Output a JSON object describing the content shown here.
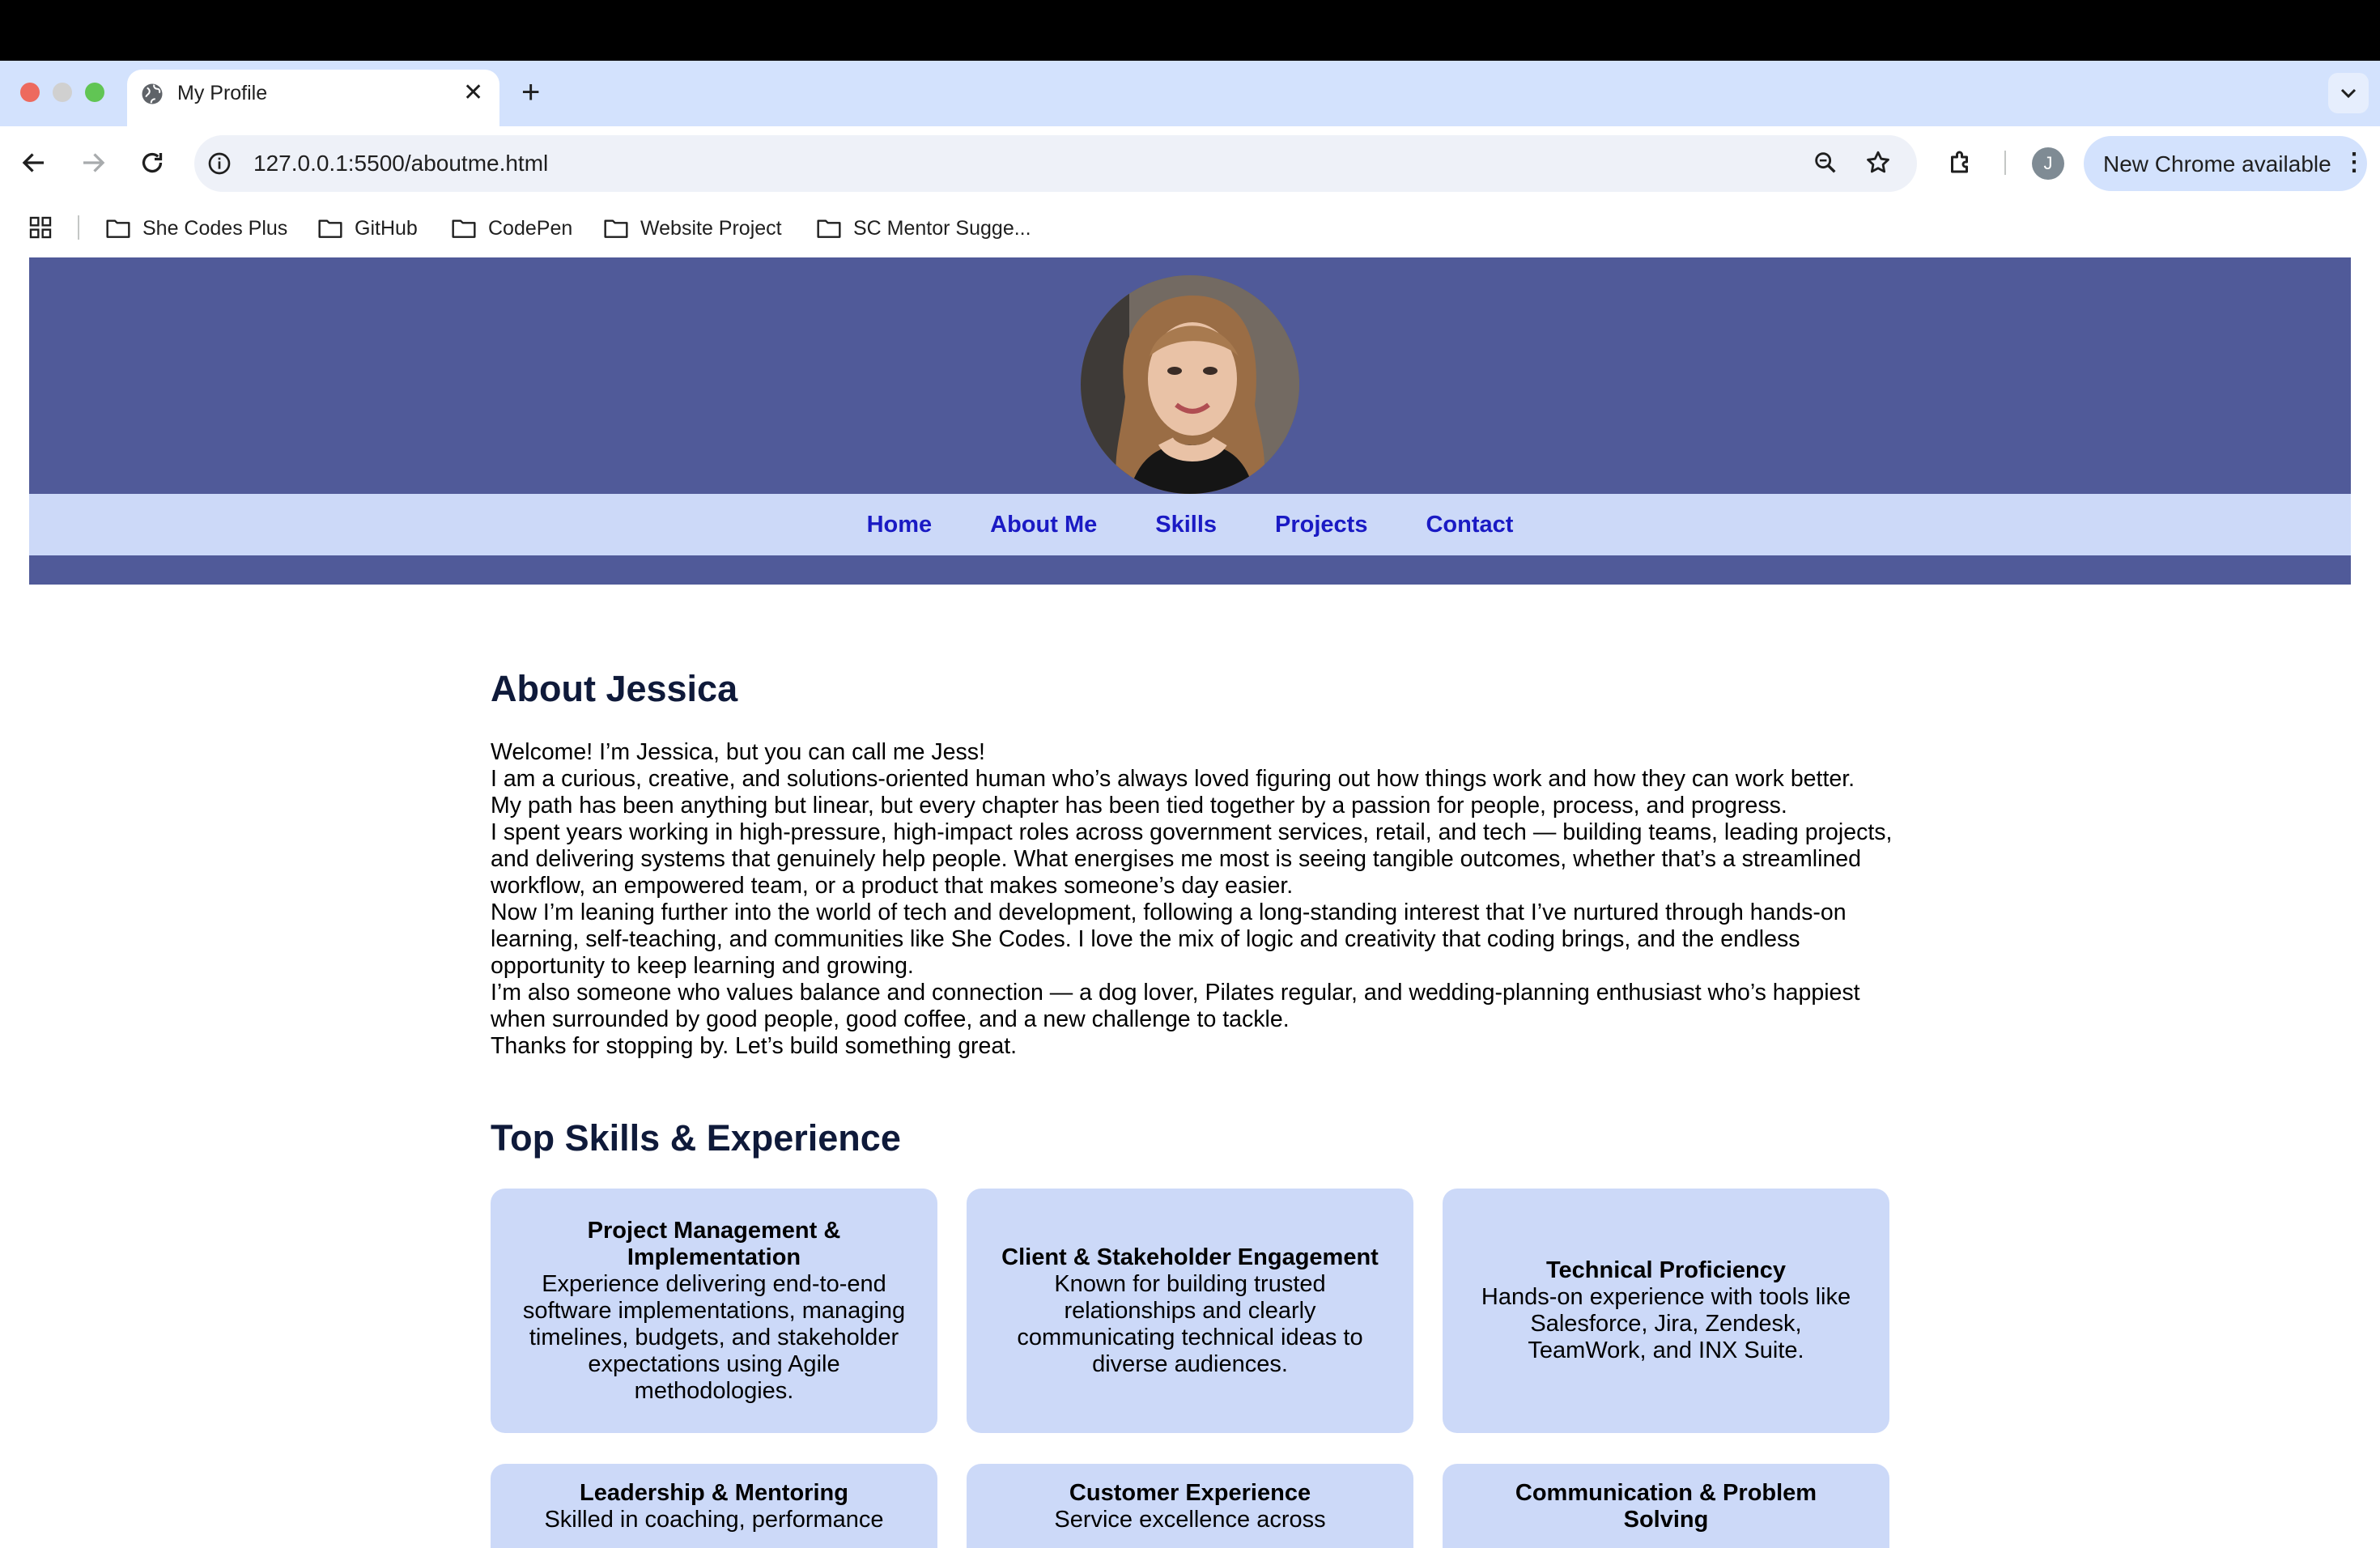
{
  "browser": {
    "tab_title": "My Profile",
    "tab_close": "✕",
    "new_tab": "+",
    "url": "127.0.0.1:5500/aboutme.html",
    "account_initial": "J",
    "update_label": "New Chrome available",
    "update_menu": "⋮",
    "bookmarks": [
      "She Codes Plus",
      "GitHub",
      "CodePen",
      "Website Project",
      "SC Mentor Sugge..."
    ]
  },
  "nav": {
    "links": [
      "Home",
      "About Me",
      "Skills",
      "Projects",
      "Contact"
    ]
  },
  "about": {
    "title": "About Jessica",
    "paragraphs": [
      "Welcome! I’m Jessica, but you can call me Jess!",
      "I am a curious, creative, and solutions-oriented human who’s always loved figuring out how things work and how they can work better.",
      "My path has been anything but linear, but every chapter has been tied together by a passion for people, process, and progress.",
      "I spent years working in high-pressure, high-impact roles across government services, retail, and tech — building teams, leading projects, and delivering systems that genuinely help people. What energises me most is seeing tangible outcomes, whether that’s a streamlined workflow, an empowered team, or a product that makes someone’s day easier.",
      "Now I’m leaning further into the world of tech and development, following a long-standing interest that I’ve nurtured through hands-on learning, self-teaching, and communities like She Codes. I love the mix of logic and creativity that coding brings, and the endless opportunity to keep learning and growing.",
      "I’m also someone who values balance and connection — a dog lover, Pilates regular, and wedding-planning enthusiast who’s happiest when surrounded by good people, good coffee, and a new challenge to tackle.",
      "Thanks for stopping by. Let’s build something great."
    ]
  },
  "skills": {
    "title": "Top Skills & Experience",
    "cards": [
      {
        "title": "Project Management & Implementation",
        "text": "Experience delivering end-to-end software implementations, managing timelines, budgets, and stakeholder expectations using Agile methodologies."
      },
      {
        "title": "Client & Stakeholder Engagement",
        "text": "Known for building trusted relationships and clearly communicating technical ideas to diverse audiences."
      },
      {
        "title": "Technical Proficiency",
        "text": "Hands-on experience with tools like Salesforce, Jira, Zendesk, TeamWork, and INX Suite."
      },
      {
        "title": "Leadership & Mentoring",
        "text": "Skilled in coaching, performance"
      },
      {
        "title": "Customer Experience",
        "text": "Service excellence across"
      },
      {
        "title": "Communication & Problem Solving",
        "text": ""
      }
    ]
  },
  "colors": {
    "header": "#505a99",
    "nav_bg": "#ccd9f8",
    "nav_link": "#1a1ac4",
    "card_bg": "#ccd9f8",
    "heading": "#0f1a3a"
  }
}
